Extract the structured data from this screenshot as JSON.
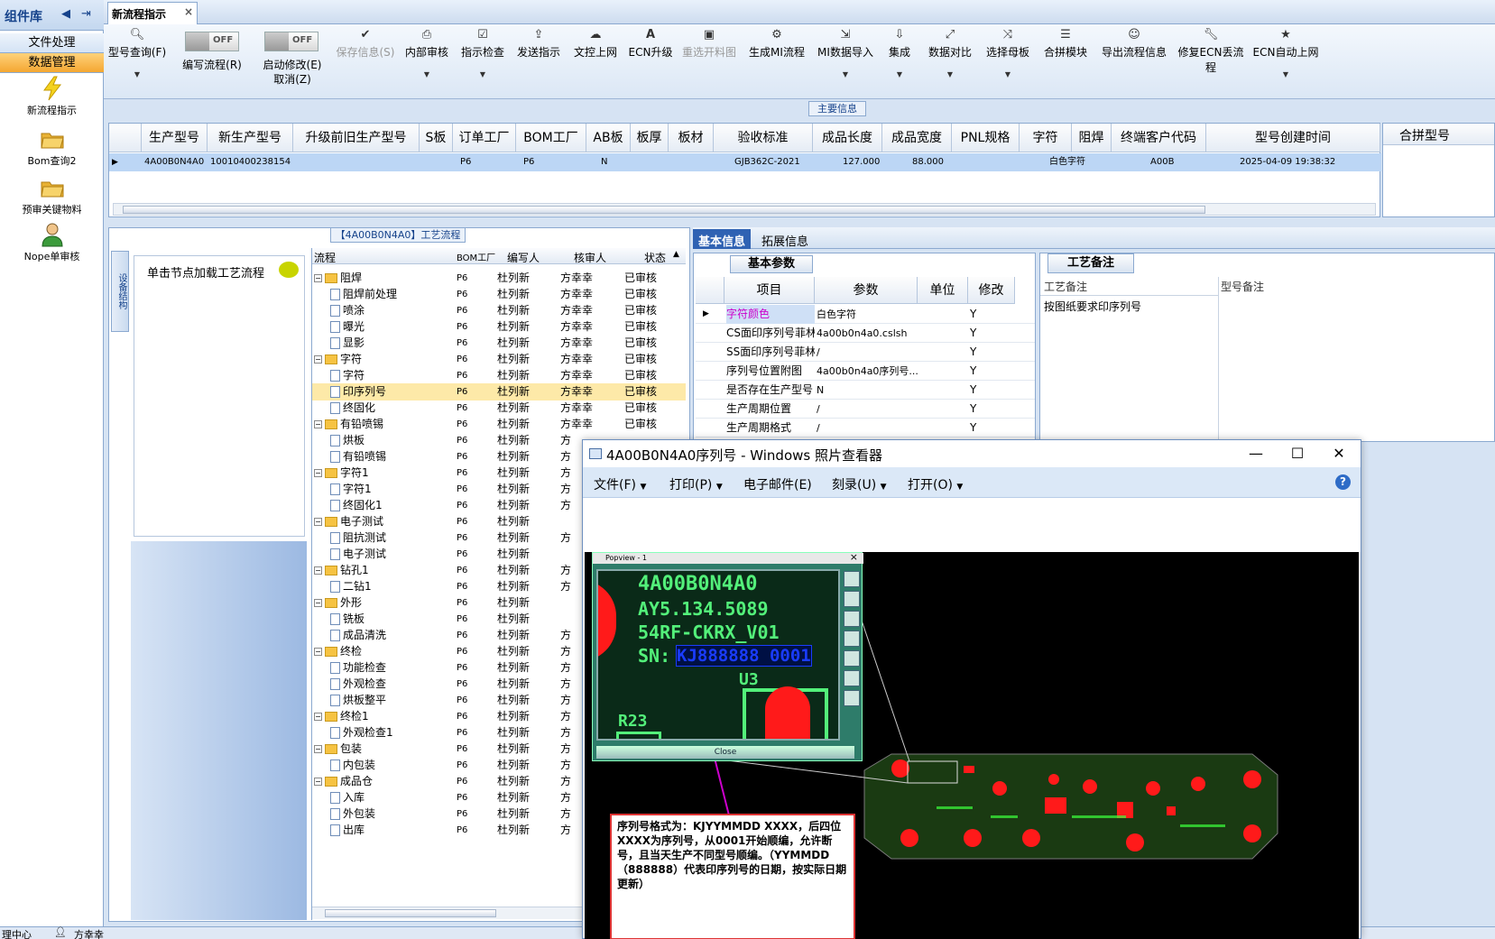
{
  "left_panel": {
    "title": "组件库",
    "groups": [
      "文件处理",
      "数据管理"
    ],
    "items": [
      {
        "label": "新流程指示",
        "icon": "lightning-icon"
      },
      {
        "label": "Bom查询2",
        "icon": "folder-open-icon"
      },
      {
        "label": "预审关键物料",
        "icon": "folder-open-icon"
      },
      {
        "label": "Nope单审核",
        "icon": "user-icon"
      }
    ]
  },
  "tabbar": {
    "tab_label": "新流程指示",
    "close": "×"
  },
  "toolbar": {
    "buttons": [
      {
        "label": "型号查询(F)",
        "icon": "search-icon",
        "dropdown": true,
        "enabled": true
      },
      {
        "label": "保存信息(S)",
        "icon": "check-icon",
        "dropdown": false,
        "enabled": false
      },
      {
        "label": "内部审核",
        "icon": "print-icon",
        "dropdown": true,
        "enabled": true
      },
      {
        "label": "指示检查",
        "icon": "checkbox-icon",
        "dropdown": true,
        "enabled": true
      },
      {
        "label": "发送指示",
        "icon": "upload-icon",
        "dropdown": false,
        "enabled": true
      },
      {
        "label": "文控上网",
        "icon": "cloud-icon",
        "dropdown": false,
        "enabled": true
      },
      {
        "label": "ECN升级",
        "icon": "a-icon",
        "dropdown": false,
        "enabled": true
      },
      {
        "label": "重选开料图",
        "icon": "image-icon",
        "dropdown": false,
        "enabled": false
      },
      {
        "label": "生成MI流程",
        "icon": "gears-icon",
        "dropdown": false,
        "enabled": true
      },
      {
        "label": "MI数据导入",
        "icon": "import-icon",
        "dropdown": true,
        "enabled": true
      },
      {
        "label": "集成",
        "icon": "download-icon",
        "dropdown": true,
        "enabled": true
      },
      {
        "label": "数据对比",
        "icon": "compare-icon",
        "dropdown": true,
        "enabled": true
      },
      {
        "label": "选择母板",
        "icon": "shuffle-icon",
        "dropdown": true,
        "enabled": true
      },
      {
        "label": "合拼模块",
        "icon": "list-icon",
        "dropdown": false,
        "enabled": true
      },
      {
        "label": "导出流程信息",
        "icon": "smile-icon",
        "dropdown": false,
        "enabled": true
      },
      {
        "label": "修复ECN丢流程",
        "icon": "wrench-icon",
        "dropdown": false,
        "enabled": true
      },
      {
        "label": "ECN自动上网",
        "icon": "star-icon",
        "dropdown": true,
        "enabled": true
      }
    ],
    "toggles": [
      {
        "state": "OFF",
        "label": "编写流程(R)"
      },
      {
        "state": "OFF",
        "label": "启动修改(E)",
        "label2": "取消(Z)"
      }
    ]
  },
  "main_info": {
    "title": "主要信息",
    "columns": [
      "生产型号",
      "新生产型号",
      "升级前旧生产型号",
      "S板",
      "订单工厂",
      "BOM工厂",
      "AB板",
      "板厚",
      "板材",
      "验收标准",
      "成品长度",
      "成品宽度",
      "PNL规格",
      "字符",
      "阻焊",
      "终端客户代码",
      "型号创建时间"
    ],
    "row": [
      "4A00B0N4A0",
      "10010400238154",
      "",
      "",
      "P6",
      "P6",
      "N",
      "",
      "",
      "GJB362C-2021",
      "127.000",
      "88.000",
      "",
      "白色字符",
      "",
      "A00B",
      "2025-04-09 19:38:32"
    ],
    "right_col_header": "合拼型号"
  },
  "process": {
    "title": "【4A00B0N4A0】工艺流程",
    "side_tab": "设备结构",
    "load_hint": "单击节点加载工艺流程",
    "columns": [
      "流程",
      "BOM工厂",
      "编写人",
      "核审人",
      "状态"
    ],
    "rows": [
      {
        "name": "阻焊",
        "type": "folder",
        "f": "P6",
        "w": "杜列新",
        "r": "方幸幸",
        "s": "已审核"
      },
      {
        "name": "阻焊前处理",
        "type": "doc",
        "f": "P6",
        "w": "杜列新",
        "r": "方幸幸",
        "s": "已审核"
      },
      {
        "name": "喷涂",
        "type": "doc",
        "f": "P6",
        "w": "杜列新",
        "r": "方幸幸",
        "s": "已审核"
      },
      {
        "name": "曝光",
        "type": "doc",
        "f": "P6",
        "w": "杜列新",
        "r": "方幸幸",
        "s": "已审核"
      },
      {
        "name": "显影",
        "type": "doc",
        "f": "P6",
        "w": "杜列新",
        "r": "方幸幸",
        "s": "已审核"
      },
      {
        "name": "字符",
        "type": "folder",
        "f": "P6",
        "w": "杜列新",
        "r": "方幸幸",
        "s": "已审核"
      },
      {
        "name": "字符",
        "type": "doc",
        "f": "P6",
        "w": "杜列新",
        "r": "方幸幸",
        "s": "已审核"
      },
      {
        "name": "印序列号",
        "type": "doc",
        "f": "P6",
        "w": "杜列新",
        "r": "方幸幸",
        "s": "已审核",
        "selected": true
      },
      {
        "name": "终固化",
        "type": "doc",
        "f": "P6",
        "w": "杜列新",
        "r": "方幸幸",
        "s": "已审核"
      },
      {
        "name": "有铅喷锡",
        "type": "folder",
        "f": "P6",
        "w": "杜列新",
        "r": "方幸幸",
        "s": "已审核"
      },
      {
        "name": "烘板",
        "type": "doc",
        "f": "P6",
        "w": "杜列新",
        "r": "方",
        "s": ""
      },
      {
        "name": "有铅喷锡",
        "type": "doc",
        "f": "P6",
        "w": "杜列新",
        "r": "方",
        "s": ""
      },
      {
        "name": "字符1",
        "type": "folder",
        "f": "P6",
        "w": "杜列新",
        "r": "方",
        "s": ""
      },
      {
        "name": "字符1",
        "type": "doc",
        "f": "P6",
        "w": "杜列新",
        "r": "方",
        "s": ""
      },
      {
        "name": "终固化1",
        "type": "doc",
        "f": "P6",
        "w": "杜列新",
        "r": "方",
        "s": ""
      },
      {
        "name": "电子测试",
        "type": "folder",
        "f": "P6",
        "w": "杜列新",
        "r": "",
        "s": ""
      },
      {
        "name": "阻抗测试",
        "type": "doc",
        "f": "P6",
        "w": "杜列新",
        "r": "方",
        "s": ""
      },
      {
        "name": "电子测试",
        "type": "doc",
        "f": "P6",
        "w": "杜列新",
        "r": "",
        "s": ""
      },
      {
        "name": "钻孔1",
        "type": "folder",
        "f": "P6",
        "w": "杜列新",
        "r": "方",
        "s": ""
      },
      {
        "name": "二钻1",
        "type": "doc",
        "f": "P6",
        "w": "杜列新",
        "r": "方",
        "s": ""
      },
      {
        "name": "外形",
        "type": "folder",
        "f": "P6",
        "w": "杜列新",
        "r": "",
        "s": ""
      },
      {
        "name": "铣板",
        "type": "doc",
        "f": "P6",
        "w": "杜列新",
        "r": "",
        "s": ""
      },
      {
        "name": "成品清洗",
        "type": "doc",
        "f": "P6",
        "w": "杜列新",
        "r": "方",
        "s": ""
      },
      {
        "name": "终检",
        "type": "folder",
        "f": "P6",
        "w": "杜列新",
        "r": "方",
        "s": ""
      },
      {
        "name": "功能检查",
        "type": "doc",
        "f": "P6",
        "w": "杜列新",
        "r": "方",
        "s": ""
      },
      {
        "name": "外观检查",
        "type": "doc",
        "f": "P6",
        "w": "杜列新",
        "r": "方",
        "s": ""
      },
      {
        "name": "烘板整平",
        "type": "doc",
        "f": "P6",
        "w": "杜列新",
        "r": "方",
        "s": ""
      },
      {
        "name": "终检1",
        "type": "folder",
        "f": "P6",
        "w": "杜列新",
        "r": "方",
        "s": ""
      },
      {
        "name": "外观检查1",
        "type": "doc",
        "f": "P6",
        "w": "杜列新",
        "r": "方",
        "s": ""
      },
      {
        "name": "包装",
        "type": "folder",
        "f": "P6",
        "w": "杜列新",
        "r": "方",
        "s": ""
      },
      {
        "name": "内包装",
        "type": "doc",
        "f": "P6",
        "w": "杜列新",
        "r": "方",
        "s": ""
      },
      {
        "name": "成品仓",
        "type": "folder",
        "f": "P6",
        "w": "杜列新",
        "r": "方",
        "s": ""
      },
      {
        "name": "入库",
        "type": "doc",
        "f": "P6",
        "w": "杜列新",
        "r": "方",
        "s": ""
      },
      {
        "name": "外包装",
        "type": "doc",
        "f": "P6",
        "w": "杜列新",
        "r": "方",
        "s": ""
      },
      {
        "name": "出库",
        "type": "doc",
        "f": "P6",
        "w": "杜列新",
        "r": "方",
        "s": ""
      }
    ]
  },
  "basic": {
    "tabs": [
      "基本信息",
      "拓展信息"
    ],
    "param_tab": "基本参数",
    "columns": [
      "项目",
      "参数",
      "单位",
      "修改"
    ],
    "rows": [
      {
        "item": "字符颜色",
        "param": "白色字符",
        "unit": "",
        "mod": "Y"
      },
      {
        "item": "CS面印序列号菲林",
        "param": "4a00b0n4a0.cslsh",
        "unit": "",
        "mod": "Y"
      },
      {
        "item": "SS面印序列号菲林",
        "param": "/",
        "unit": "",
        "mod": "Y"
      },
      {
        "item": "序列号位置附图",
        "param": "4a00b0n4a0序列号...",
        "unit": "",
        "mod": "Y"
      },
      {
        "item": "是否存在生产型号",
        "param": "N",
        "unit": "",
        "mod": "Y"
      },
      {
        "item": "生产周期位置",
        "param": "/",
        "unit": "",
        "mod": "Y"
      },
      {
        "item": "生产周期格式",
        "param": "/",
        "unit": "",
        "mod": "Y"
      }
    ],
    "highlight_color": "#cc00cc"
  },
  "craft_note": {
    "tab": "工艺备注",
    "col1": "工艺备注",
    "col2": "型号备注",
    "text": "按图纸要求印序列号"
  },
  "statusbar": {
    "left": "理中心",
    "user": "方幸幸"
  },
  "viewer": {
    "title": "4A00B0N4A0序列号 - Windows 照片查看器",
    "menu": [
      "文件(F)",
      "打印(P)",
      "电子邮件(E)",
      "刻录(U)",
      "打开(O)"
    ],
    "help": "?",
    "popview": {
      "title": "Popview - 1",
      "line1": "4A00B0N4A0",
      "line2": "AY5.134.5089",
      "line3": "54RF-CKRX_V01",
      "sn_label": "SN:",
      "sn_value": "KJ888888 0001",
      "u3": "U3",
      "r23": "R23",
      "close": "Close"
    },
    "annotation": "序列号格式为：KJYYMMDD XXXX，后四位XXXX为序列号，从0001开始顺编，允许断号，且当天生产不同型号顺编。（YYMMDD（888888）代表印序列号的日期，按实际日期更新）"
  }
}
